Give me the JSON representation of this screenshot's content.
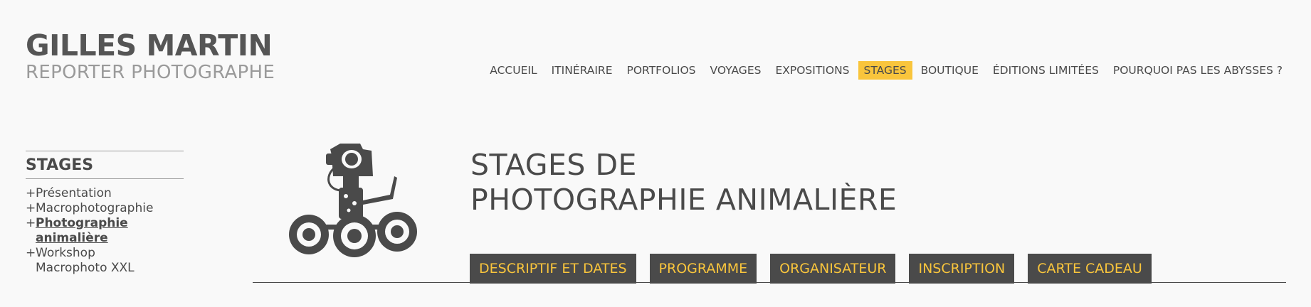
{
  "brand": {
    "name": "GILLES MARTIN",
    "subtitle": "REPORTER PHOTOGRAPHE"
  },
  "nav": {
    "items": [
      {
        "label": "ACCUEIL"
      },
      {
        "label": "ITINÉRAIRE"
      },
      {
        "label": "PORTFOLIOS"
      },
      {
        "label": "VOYAGES"
      },
      {
        "label": "EXPOSITIONS"
      },
      {
        "label": "STAGES",
        "active": true
      },
      {
        "label": "BOUTIQUE"
      },
      {
        "label": "ÉDITIONS LIMITÉES"
      },
      {
        "label": "POURQUOI PAS LES ABYSSES ?"
      }
    ]
  },
  "sidebar": {
    "title": "STAGES",
    "bullet": "+",
    "items": [
      {
        "label": "Présentation"
      },
      {
        "label": "Macrophotographie"
      },
      {
        "label": "Photographie animalière",
        "current": true
      },
      {
        "label": "Workshop\nMacrophoto XXL"
      }
    ]
  },
  "page": {
    "title_line1": "STAGES DE",
    "title_line2": "PHOTOGRAPHIE ANIMALIÈRE"
  },
  "tabs": [
    {
      "label": "DESCRIPTIF ET DATES"
    },
    {
      "label": "PROGRAMME"
    },
    {
      "label": "ORGANISATEUR"
    },
    {
      "label": "INSCRIPTION"
    },
    {
      "label": "CARTE CADEAU"
    }
  ],
  "illustration": {
    "icon": "camera-robot-rover-icon"
  },
  "colors": {
    "background": "#f9f9f9",
    "text": "#4a4a4a",
    "accent": "#f9c53c",
    "tab_bg": "#4a4a4a"
  }
}
